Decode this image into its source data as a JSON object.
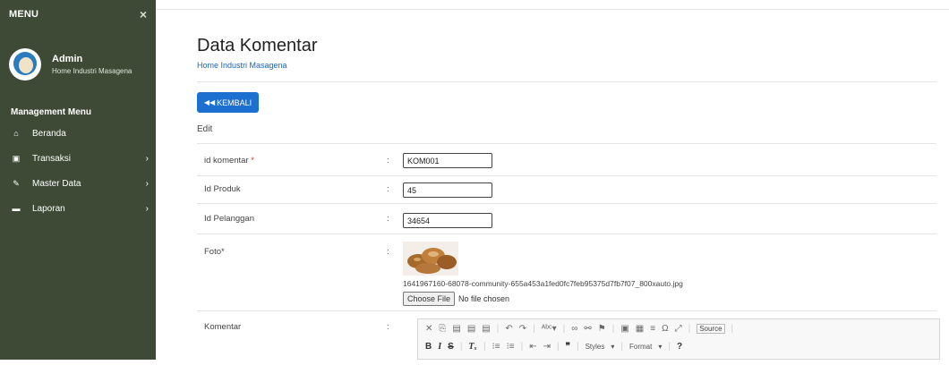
{
  "sidebar": {
    "menu_title": "MENU",
    "close_glyph": "×",
    "user_name": "Admin",
    "user_subtitle": "Home Industri Masagena",
    "section_title": "Management Menu",
    "items": [
      {
        "label": "Beranda",
        "icon": "home-icon",
        "glyph": "⌂"
      },
      {
        "label": "Transaksi",
        "icon": "cart-icon",
        "glyph": "▣",
        "arrow": "›"
      },
      {
        "label": "Master Data",
        "icon": "edit-icon",
        "glyph": "✎",
        "arrow": "›"
      },
      {
        "label": "Laporan",
        "icon": "folder-icon",
        "glyph": "▬",
        "arrow": "›"
      }
    ],
    "colors": {
      "background": "#3e4a36"
    }
  },
  "header": {
    "title": "Data Komentar",
    "breadcrumb": "Home Industri Masagena"
  },
  "toolbar": {
    "back_icon": "◀◀",
    "back_label": "KEMBALI"
  },
  "form": {
    "section_label": "Edit",
    "colon": ":",
    "fields": {
      "id_komentar": {
        "label": "id komentar",
        "required_mark": "*",
        "value": "KOM001"
      },
      "id_produk": {
        "label": "Id Produk",
        "value": "45"
      },
      "id_pelanggan": {
        "label": "Id Pelanggan",
        "value": "34654"
      },
      "foto": {
        "label": "Foto*",
        "filename": "1641967160-68078-community-655a453a1fed0fc7feb95375d7fb7f07_800xauto.jpg",
        "choose_label": "Choose File",
        "no_file": "No file chosen"
      },
      "komentar": {
        "label": "Komentar"
      }
    }
  },
  "editor": {
    "row1": [
      "✕",
      "⎘",
      "▤",
      "▤",
      "▤",
      "|",
      "↶",
      "↷",
      "|",
      "ᴬᵇᶜ▾",
      "|",
      "∞",
      "⚯",
      "⚑",
      "|",
      "▣",
      "▦",
      "≡",
      "Ω",
      "⤢",
      "|",
      "Source",
      "|"
    ],
    "row2": [
      "B",
      "I",
      "S",
      "|",
      "Tₓ",
      "|",
      "⁝≡",
      "⁝≡",
      "|",
      "⇤",
      "⇥",
      "|",
      "❞",
      "|",
      "Styles",
      "▾",
      "|",
      "Format",
      "▾",
      "|",
      "?"
    ]
  },
  "colors": {
    "accent": "#1d6fd0",
    "link": "#1a64b8",
    "required": "#e03131"
  }
}
